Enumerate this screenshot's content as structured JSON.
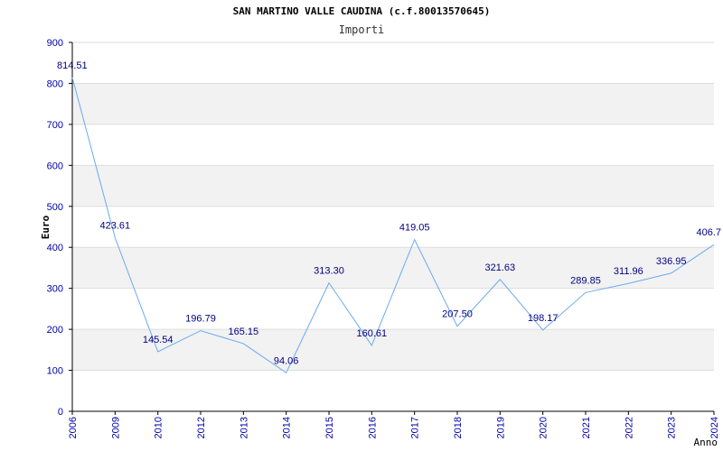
{
  "chart_data": {
    "type": "line",
    "title": "SAN MARTINO VALLE CAUDINA (c.f.80013570645)",
    "subtitle": "Importi",
    "ylabel": "Euro",
    "xlabel": "Anno",
    "ylim": [
      0,
      900
    ],
    "yticks": [
      0,
      100,
      200,
      300,
      400,
      500,
      600,
      700,
      800,
      900
    ],
    "categories": [
      "2006",
      "2009",
      "2010",
      "2012",
      "2013",
      "2014",
      "2015",
      "2016",
      "2017",
      "2018",
      "2019",
      "2020",
      "2021",
      "2022",
      "2023",
      "2024"
    ],
    "values": [
      814.51,
      423.61,
      145.54,
      196.79,
      165.15,
      94.06,
      313.3,
      160.61,
      419.05,
      207.5,
      321.63,
      198.17,
      289.85,
      311.96,
      336.95,
      406.7
    ],
    "value_labels": [
      "814.51",
      "423.61",
      "145.54",
      "196.79",
      "165.15",
      "94.06",
      "313.30",
      "160.61",
      "419.05",
      "207.50",
      "321.63",
      "198.17",
      "289.85",
      "311.96",
      "336.95",
      "406.7"
    ],
    "grid": true,
    "colors": {
      "line": "#6aaaf0",
      "band": "#f2f2f2",
      "gridline": "#dddddd",
      "tick_text": "#0000aa",
      "value_text": "#000080"
    }
  }
}
